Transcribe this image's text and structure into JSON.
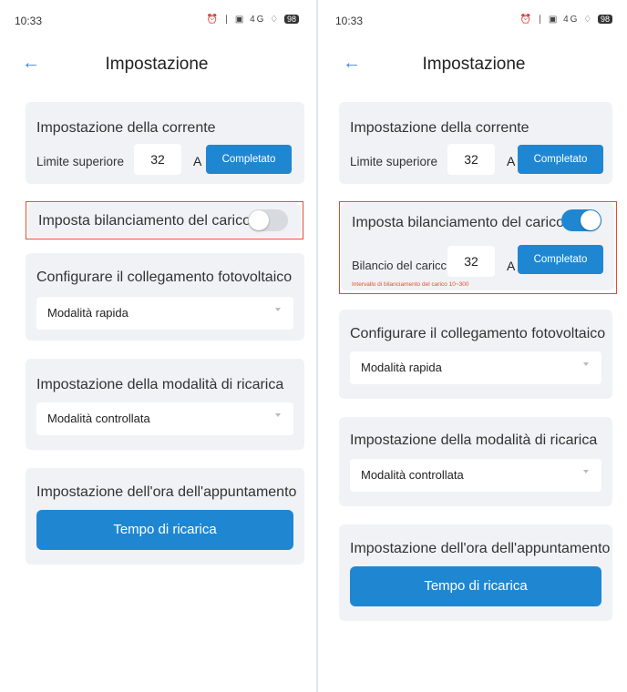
{
  "left": {
    "status": {
      "time": "10:33",
      "icons": "⏰ ∣ ▣ 4G ♢",
      "battery": "98"
    },
    "header": {
      "title": "Impostazione"
    },
    "current": {
      "title": "Impostazione della corrente",
      "limit_label": "Limite superiore",
      "limit_value": "32",
      "unit": "A",
      "button": "Completato"
    },
    "balance": {
      "label": "Imposta bilanciamento del carico",
      "enabled": false
    },
    "pv": {
      "title": "Configurare il collegamento fotovoltaico",
      "value": "Modalità rapida"
    },
    "charge_mode": {
      "title": "Impostazione della modalità di ricarica",
      "value": "Modalità controllata"
    },
    "appointment": {
      "title": "Impostazione dell'ora dell'appuntamento",
      "button": "Tempo di ricarica"
    }
  },
  "right": {
    "status": {
      "time": "10:33",
      "icons": "⏰ ∣ ▣ 4G ♢",
      "battery": "98"
    },
    "header": {
      "title": "Impostazione"
    },
    "current": {
      "title": "Impostazione della corrente",
      "limit_label": "Limite superiore",
      "limit_value": "32",
      "unit": "A",
      "button": "Completato"
    },
    "balance": {
      "label": "Imposta bilanciamento del carico",
      "enabled": true,
      "value_label": "Bilancio del caricc",
      "value": "32",
      "unit": "A",
      "button": "Completato",
      "hint": "Intervallo di bilanciamento del carico 10~300"
    },
    "pv": {
      "title": "Configurare il collegamento fotovoltaico",
      "value": "Modalità rapida"
    },
    "charge_mode": {
      "title": "Impostazione della modalità di ricarica",
      "value": "Modalità controllata"
    },
    "appointment": {
      "title": "Impostazione dell'ora dell'appuntamento",
      "button": "Tempo di ricarica"
    }
  },
  "colors": {
    "accent": "#1f87d2",
    "highlight": "#e0502f",
    "card": "#f0f2f5"
  }
}
